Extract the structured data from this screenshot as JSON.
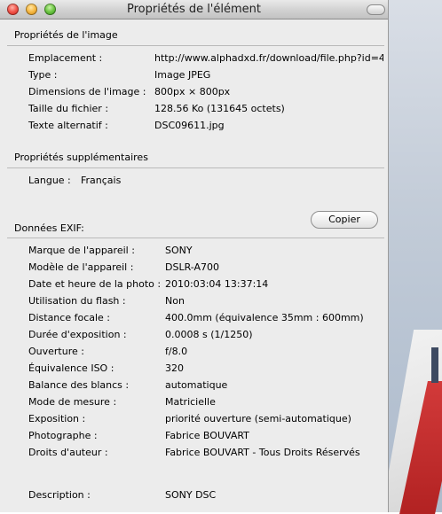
{
  "window": {
    "title": "Propriétés de l'élément"
  },
  "image_props": {
    "header": "Propriétés de l'image",
    "rows": [
      {
        "label": "Emplacement :",
        "value": "http://www.alphadxd.fr/download/file.php?id=4"
      },
      {
        "label": "Type :",
        "value": "Image JPEG"
      },
      {
        "label": "Dimensions de l'image :",
        "value": "800px × 800px"
      },
      {
        "label": "Taille du fichier :",
        "value": "128.56 Ko (131645 octets)"
      },
      {
        "label": "Texte alternatif :",
        "value": "DSC09611.jpg"
      }
    ]
  },
  "extra_props": {
    "header": "Propriétés supplémentaires",
    "language_label": "Langue :",
    "language_value": "Français"
  },
  "exif": {
    "header": "Données EXIF:",
    "copy_label": "Copier",
    "rows": [
      {
        "label": "Marque de l'appareil :",
        "value": "SONY"
      },
      {
        "label": "Modèle de l'appareil :",
        "value": "DSLR-A700"
      },
      {
        "label": "Date et heure de la photo :",
        "value": "2010:03:04 13:37:14"
      },
      {
        "label": "Utilisation du flash :",
        "value": "Non"
      },
      {
        "label": "Distance focale :",
        "value": "400.0mm (équivalence 35mm : 600mm)"
      },
      {
        "label": "Durée d'exposition :",
        "value": "0.0008 s (1/1250)"
      },
      {
        "label": "Ouverture :",
        "value": "f/8.0"
      },
      {
        "label": "Équivalence ISO :",
        "value": "320"
      },
      {
        "label": "Balance des blancs :",
        "value": "automatique"
      },
      {
        "label": "Mode de mesure :",
        "value": "Matricielle"
      },
      {
        "label": "Exposition :",
        "value": "priorité ouverture (semi-automatique)"
      },
      {
        "label": "Photographe :",
        "value": "Fabrice BOUVART"
      },
      {
        "label": "Droits d'auteur :",
        "value": "Fabrice BOUVART - Tous Droits Réservés"
      }
    ],
    "description_label": "Description :",
    "description_value": "SONY DSC"
  }
}
